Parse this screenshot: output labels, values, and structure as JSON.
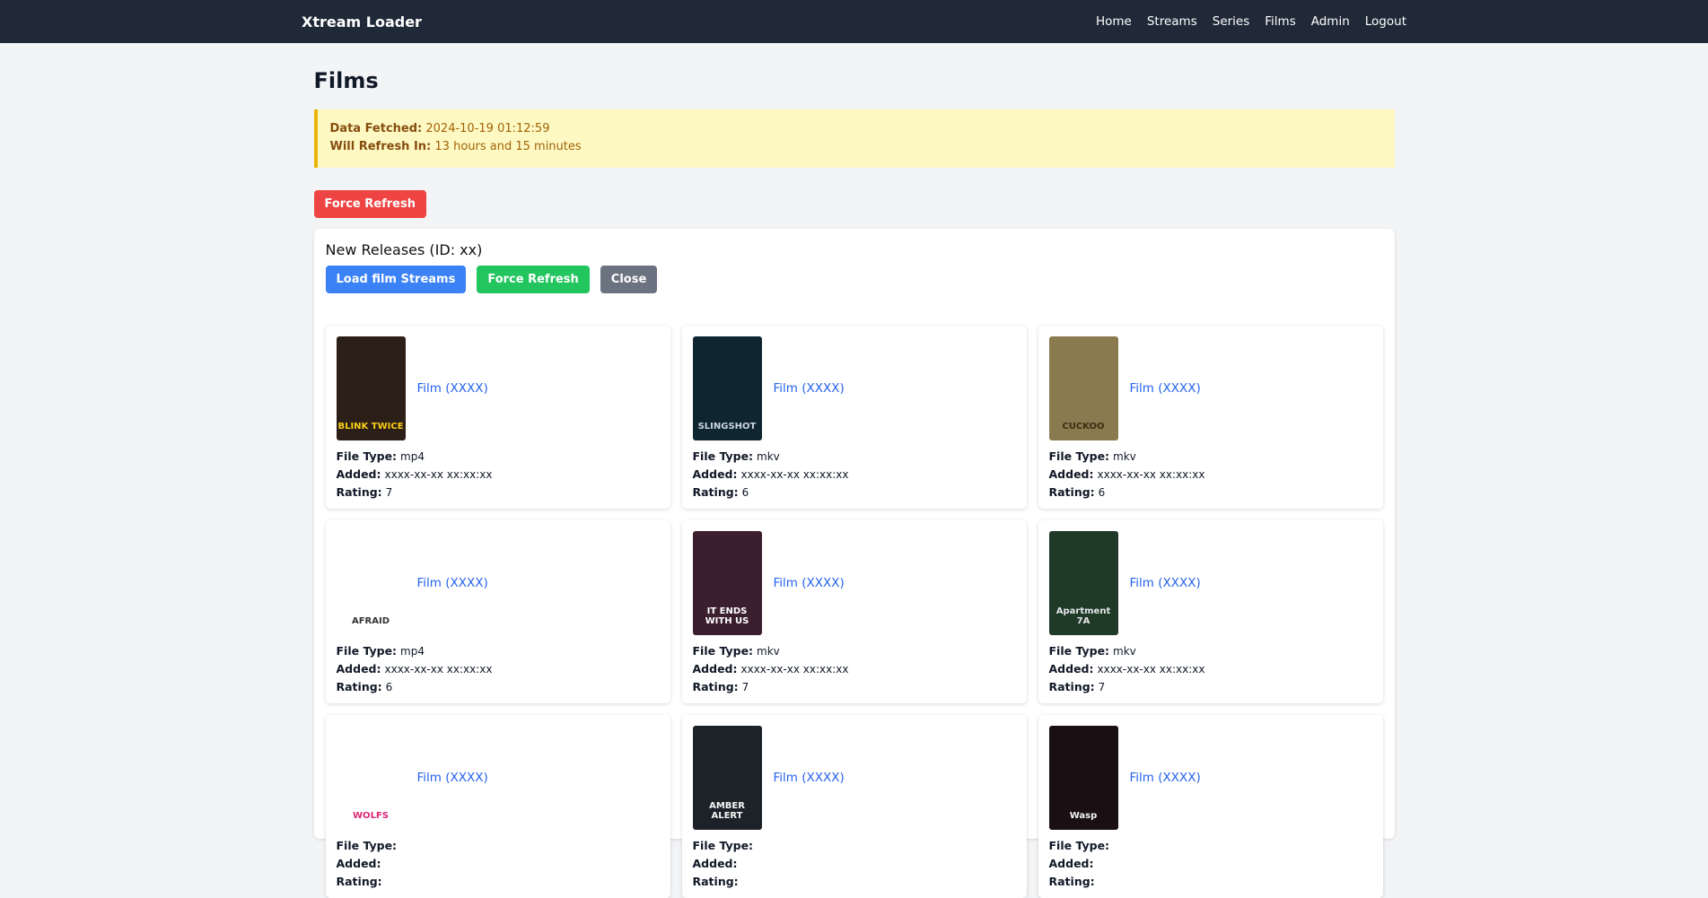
{
  "nav": {
    "brand": "Xtream Loader",
    "links": [
      "Home",
      "Streams",
      "Series",
      "Films",
      "Admin",
      "Logout"
    ]
  },
  "page": {
    "title": "Films"
  },
  "notice": {
    "fetched_label": "Data Fetched:",
    "fetched_value": "2024-10-19 01:12:59",
    "refresh_label": "Will Refresh In:",
    "refresh_value": "13 hours and 15 minutes"
  },
  "force_refresh_label": "Force Refresh",
  "panel": {
    "title": "New Releases (ID: xx)",
    "load_label": "Load film Streams",
    "refresh_label": "Force Refresh",
    "close_label": "Close"
  },
  "labels": {
    "file_type": "File Type:",
    "added": "Added:",
    "rating": "Rating:"
  },
  "films": [
    {
      "title": "Film (XXXX)",
      "file_type": "mp4",
      "added": "xxxx-xx-xx xx:xx:xx",
      "rating": "7",
      "poster_text": "BLINK TWICE",
      "poster_bg": "#2b1f17",
      "poster_fg": "#facc15"
    },
    {
      "title": "Film (XXXX)",
      "file_type": "mkv",
      "added": "xxxx-xx-xx xx:xx:xx",
      "rating": "6",
      "poster_text": "SLINGSHOT",
      "poster_bg": "#0f2530",
      "poster_fg": "#cbd5e1"
    },
    {
      "title": "Film (XXXX)",
      "file_type": "mkv",
      "added": "xxxx-xx-xx xx:xx:xx",
      "rating": "6",
      "poster_text": "CUCKOO",
      "poster_bg": "#8a7a4f",
      "poster_fg": "#3f2d12"
    },
    {
      "title": "Film (XXXX)",
      "file_type": "mp4",
      "added": "xxxx-xx-xx xx:xx:xx",
      "rating": "6",
      "poster_text": "AFRAID",
      "poster_bg": "#ffffff",
      "poster_fg": "#333333"
    },
    {
      "title": "Film (XXXX)",
      "file_type": "mkv",
      "added": "xxxx-xx-xx xx:xx:xx",
      "rating": "7",
      "poster_text": "IT ENDS WITH US",
      "poster_bg": "#3b1f2e",
      "poster_fg": "#ffffff"
    },
    {
      "title": "Film (XXXX)",
      "file_type": "mkv",
      "added": "xxxx-xx-xx xx:xx:xx",
      "rating": "7",
      "poster_text": "Apartment 7A",
      "poster_bg": "#1f3a26",
      "poster_fg": "#e5e7eb"
    },
    {
      "title": "Film (XXXX)",
      "file_type": "",
      "added": "",
      "rating": "",
      "poster_text": "WOLFS",
      "poster_bg": "#ffffff",
      "poster_fg": "#db2777"
    },
    {
      "title": "Film (XXXX)",
      "file_type": "",
      "added": "",
      "rating": "",
      "poster_text": "AMBER ALERT",
      "poster_bg": "#1c2228",
      "poster_fg": "#f5f5f4"
    },
    {
      "title": "Film (XXXX)",
      "file_type": "",
      "added": "",
      "rating": "",
      "poster_text": "Wasp",
      "poster_bg": "#1a0f12",
      "poster_fg": "#f3f4f6"
    }
  ]
}
